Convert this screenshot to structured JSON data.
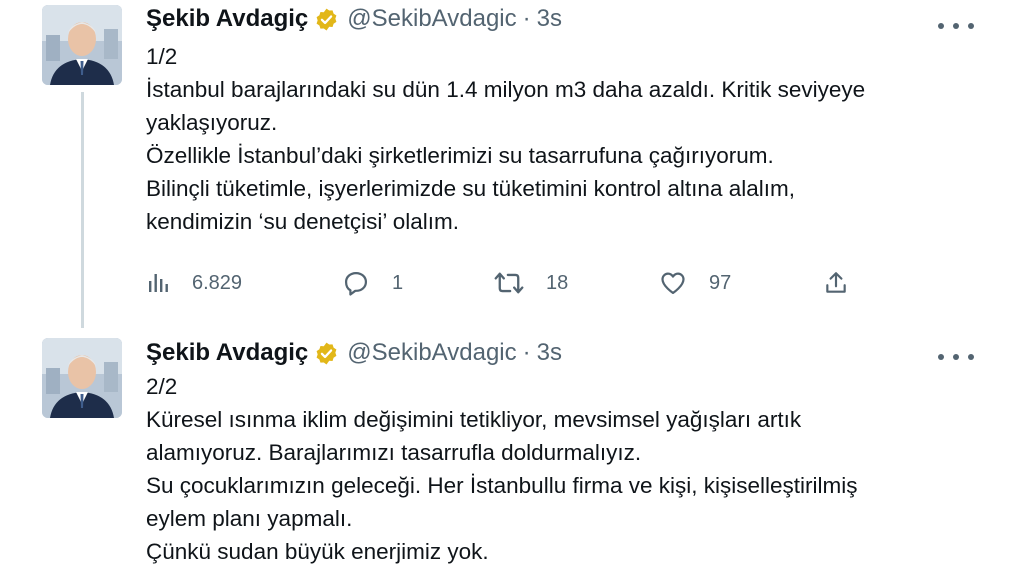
{
  "tweets": [
    {
      "author": {
        "name": "Şekib Avdagiç",
        "handle": "@SekibAvdagic",
        "time": "3s"
      },
      "dot": "·",
      "lines": [
        "1/2",
        "İstanbul barajlarındaki su dün 1.4 milyon m3 daha azaldı. Kritik seviyeye",
        "yaklaşıyoruz.",
        "Özellikle İstanbul’daki şirketlerimizi su tasarrufuna çağırıyorum.",
        "Bilinçli tüketimle, işyerlerimizde su tüketimini kontrol altına alalım,",
        "kendimizin ‘su denetçisi’ olalım."
      ],
      "stats": {
        "views": "6.829",
        "replies": "1",
        "retweets": "18",
        "likes": "97"
      }
    },
    {
      "author": {
        "name": "Şekib Avdagiç",
        "handle": "@SekibAvdagic",
        "time": "3s"
      },
      "dot": "·",
      "lines": [
        "2/2",
        "Küresel ısınma iklim değişimini tetikliyor, mevsimsel yağışları artık",
        "alamıyoruz. Barajlarımızı tasarrufla doldurmalıyız.",
        "Su çocuklarımızın geleceği. Her İstanbullu firma ve kişi, kişiselleştirilmiş",
        "eylem planı yapmalı.",
        "Çünkü sudan büyük enerjimiz yok."
      ]
    }
  ],
  "icons": {
    "verified": "verified-badge-icon",
    "more": "more-options-icon",
    "views": "analytics-icon",
    "reply": "reply-icon",
    "retweet": "retweet-icon",
    "like": "heart-icon",
    "share": "share-icon"
  },
  "colors": {
    "text": "#0f1419",
    "secondary": "#536471",
    "badge_gold": "#e2b719",
    "thread_line": "#cfd9de"
  }
}
